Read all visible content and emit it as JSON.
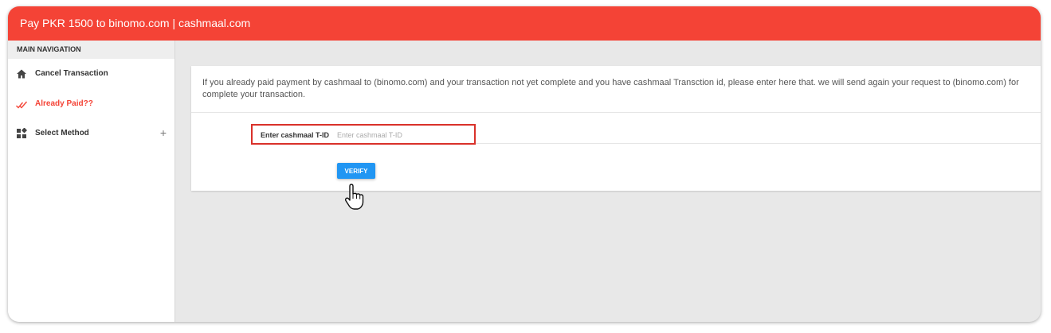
{
  "header": {
    "title": "Pay PKR 1500 to binomo.com | cashmaal.com"
  },
  "sidebar": {
    "heading": "MAIN NAVIGATION",
    "items": [
      {
        "label": "Cancel Transaction",
        "icon": "home-icon"
      },
      {
        "label": "Already Paid??",
        "icon": "double-check-icon",
        "active": true
      },
      {
        "label": "Select Method",
        "icon": "grid-icon",
        "expand": "+"
      }
    ]
  },
  "main": {
    "info": "If you already paid payment by cashmaal to (binomo.com) and your transaction not yet complete and you have cashmaal Transction id, please enter here that. we will send again your request to (binomo.com) for complete your transaction.",
    "tid": {
      "label": "Enter cashmaal T-ID",
      "placeholder": "Enter cashmaal T-ID",
      "value": ""
    },
    "verify_label": "VERIFY"
  },
  "colors": {
    "brand": "#f44336",
    "highlight_box": "#d9312a",
    "button": "#2196f3"
  }
}
